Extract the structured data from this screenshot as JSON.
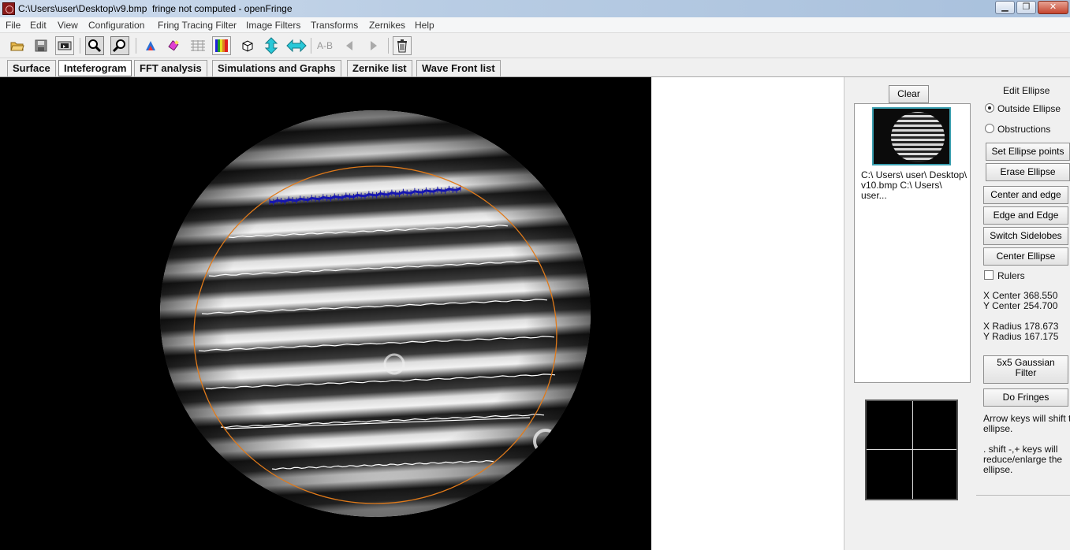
{
  "window": {
    "title": "C:\\Users\\user\\Desktop\\v9.bmp  fringe not computed - openFringe",
    "minimize": "▁",
    "maximize": "❐",
    "close": "✕"
  },
  "menu": [
    "File",
    "Edit",
    "View",
    "Configuration",
    "Fring Tracing Filter",
    "Image Filters",
    "Transforms",
    "Zernikes",
    "Help"
  ],
  "toolbar": {
    "ab_label": "A-B",
    "icons": [
      "open-folder-icon",
      "save-icon",
      "print-icon",
      "zoom-in-icon",
      "zoom-out-icon",
      "paint-icon",
      "eraser-icon",
      "grid-icon",
      "color-bars-icon",
      "cube-icon",
      "vertical-arrow-icon",
      "horizontal-arrow-icon",
      "ab-compare-icon",
      "back-arrow-icon",
      "forward-arrow-icon",
      "trash-icon"
    ]
  },
  "tabs": [
    "Surface",
    "Inteferogram",
    "FFT analysis",
    "Simulations and Graphs",
    "Zernike list",
    "Wave Front list"
  ],
  "active_tab": "Inteferogram",
  "panel": {
    "clear": "Clear",
    "edit_ellipse_title": "Edit Ellipse",
    "outside_ellipse": "Outside Ellipse",
    "obstructions": "Obstructions",
    "set_ellipse_points": "Set Ellipse points",
    "erase_ellipse": "Erase Ellipse",
    "center_and_edge": "Center and edge",
    "edge_and_edge": "Edge and Edge",
    "switch_sidelobes": "Switch Sidelobes",
    "center_ellipse": "Center Ellipse",
    "rulers": "Rulers",
    "x_center_label": "X Center",
    "x_center_value": "368.550",
    "y_center_label": "Y Center",
    "y_center_value": "254.700",
    "x_radius_label": "X Radius",
    "x_radius_value": "178.673",
    "y_radius_label": "Y Radius",
    "y_radius_value": "167.175",
    "gaussian_line1": "5x5 Gaussian",
    "gaussian_line2": "Filter",
    "do_fringes": "Do Fringes",
    "hint1_line1": "Arrow keys will shift the",
    "hint1_line2": "ellipse.",
    "hint2_line1": ".  shift -,+ keys will",
    "hint2_line2": "reduce/enlarge the",
    "hint2_line3": "ellipse.",
    "list_line1": "C:\\ Users\\ user\\ Desktop\\",
    "list_line2": "v10.bmp C:\\ Users\\ user..."
  }
}
